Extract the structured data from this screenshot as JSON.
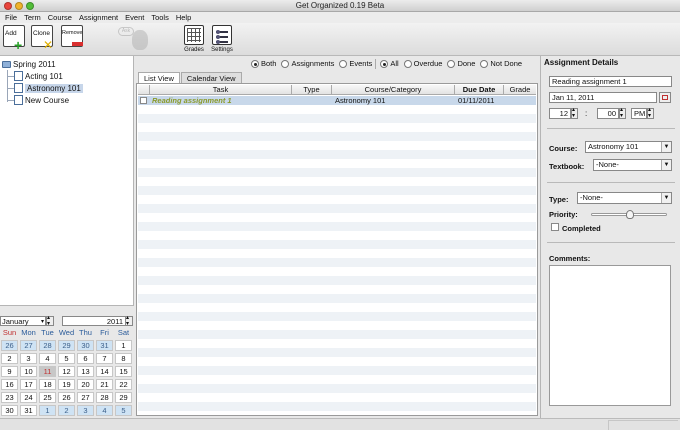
{
  "window": {
    "title": "Get Organized 0.19 Beta"
  },
  "menu": [
    "File",
    "Term",
    "Course",
    "Assignment",
    "Event",
    "Tools",
    "Help"
  ],
  "toolbar": {
    "add": "Add",
    "clone": "Clone",
    "remove": "Remove",
    "ask": "Ask",
    "grades": "Grades",
    "settings": "Settings"
  },
  "tree": {
    "term": "Spring 2011",
    "courses": [
      "Acting 101",
      "Astronomy 101",
      "New Course"
    ],
    "selected_index": 1
  },
  "calendar": {
    "month": "January",
    "year": "2011",
    "days": [
      "Sun",
      "Mon",
      "Tue",
      "Wed",
      "Thu",
      "Fri",
      "Sat"
    ],
    "cells": [
      "26",
      "27",
      "28",
      "29",
      "30",
      "31",
      "1",
      "2",
      "3",
      "4",
      "5",
      "6",
      "7",
      "8",
      "9",
      "10",
      "11",
      "12",
      "13",
      "14",
      "15",
      "16",
      "17",
      "18",
      "19",
      "20",
      "21",
      "22",
      "23",
      "24",
      "25",
      "26",
      "27",
      "28",
      "29",
      "30",
      "31",
      "1",
      "2",
      "3",
      "4",
      "5"
    ],
    "other_month_indices": [
      0,
      1,
      2,
      3,
      4,
      5,
      37,
      38,
      39,
      40,
      41
    ],
    "today_index": 16,
    "colors": {
      "weekday_header": "#2a5b9a",
      "sunday_header": "#c03030",
      "other_month_bg": "#cfe3f4"
    }
  },
  "filters": {
    "type": [
      "Both",
      "Assignments",
      "Events"
    ],
    "type_selected": "Both",
    "status": [
      "All",
      "Overdue",
      "Done",
      "Not Done"
    ],
    "status_selected": "All"
  },
  "tabs": [
    "List View",
    "Calendar View"
  ],
  "table": {
    "columns": [
      "",
      "Task",
      "Type",
      "Course/Category",
      "Due Date",
      "Grade"
    ],
    "rows": [
      {
        "task": "Reading assignment 1",
        "type": "",
        "course": "Astronomy 101",
        "due": "01/11/2011",
        "grade": ""
      }
    ],
    "colors": {
      "task_text": "#8a9a2a",
      "selected_row": "#c8d8ea"
    }
  },
  "details": {
    "heading": "Assignment Details",
    "name": "Reading assignment 1",
    "date": "Jan 11, 2011",
    "hour": "12",
    "minute": "00",
    "ampm": "PM",
    "course_label": "Course:",
    "course": "Astronomy 101",
    "textbook_label": "Textbook:",
    "textbook": "-None-",
    "type_label": "Type:",
    "type": "-None-",
    "priority_label": "Priority:",
    "priority_level": 0.5,
    "completed_label": "Completed",
    "comments_label": "Comments:"
  }
}
